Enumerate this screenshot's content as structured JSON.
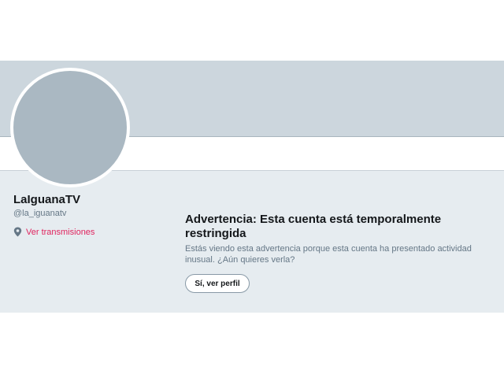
{
  "profile": {
    "name": "LaIguanaTV",
    "handle": "@la_iguanatv",
    "periscope_link": "Ver transmisiones",
    "periscope_icon": "location-pin-icon"
  },
  "warning": {
    "title": "Advertencia: Esta cuenta está temporalmente restringida",
    "body": "Estás viendo esta advertencia porque esta cuenta ha presentado actividad inusual. ¿Aún quieres verla?",
    "button_label": "Sí, ver perfil"
  },
  "colors": {
    "banner": "#ccd6dd",
    "content_bg": "#e6ecf0",
    "avatar": "#aab8c2",
    "link": "#e0245e"
  }
}
